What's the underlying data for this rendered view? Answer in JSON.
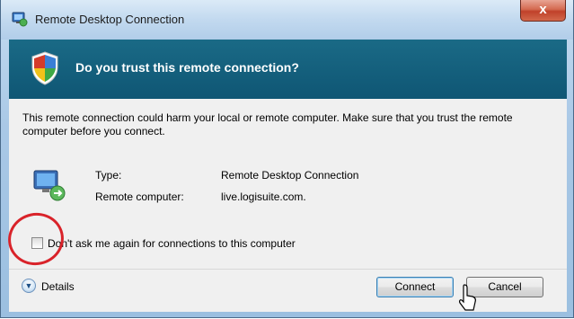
{
  "window": {
    "title": "Remote Desktop Connection",
    "close_label": "x"
  },
  "banner": {
    "title": "Do you trust this remote connection?"
  },
  "content": {
    "warning": "This remote connection could harm your local or remote computer. Make sure that you trust the remote computer before you connect.",
    "type_label": "Type:",
    "type_value": "Remote Desktop Connection",
    "computer_label": "Remote computer:",
    "computer_value": "live.logisuite.com.",
    "checkbox_label": "Don't ask me again for connections to this computer",
    "checkbox_checked": false
  },
  "footer": {
    "details_label": "Details",
    "connect_label": "Connect",
    "cancel_label": "Cancel"
  },
  "icons": [
    "remote-desktop-app-icon",
    "security-shield-icon",
    "remote-computer-icon",
    "expand-details-icon",
    "mouse-cursor-icon"
  ],
  "colors": {
    "banner": "#0f5674",
    "highlight_circle": "#d9232a",
    "close_button": "#c0412a"
  }
}
